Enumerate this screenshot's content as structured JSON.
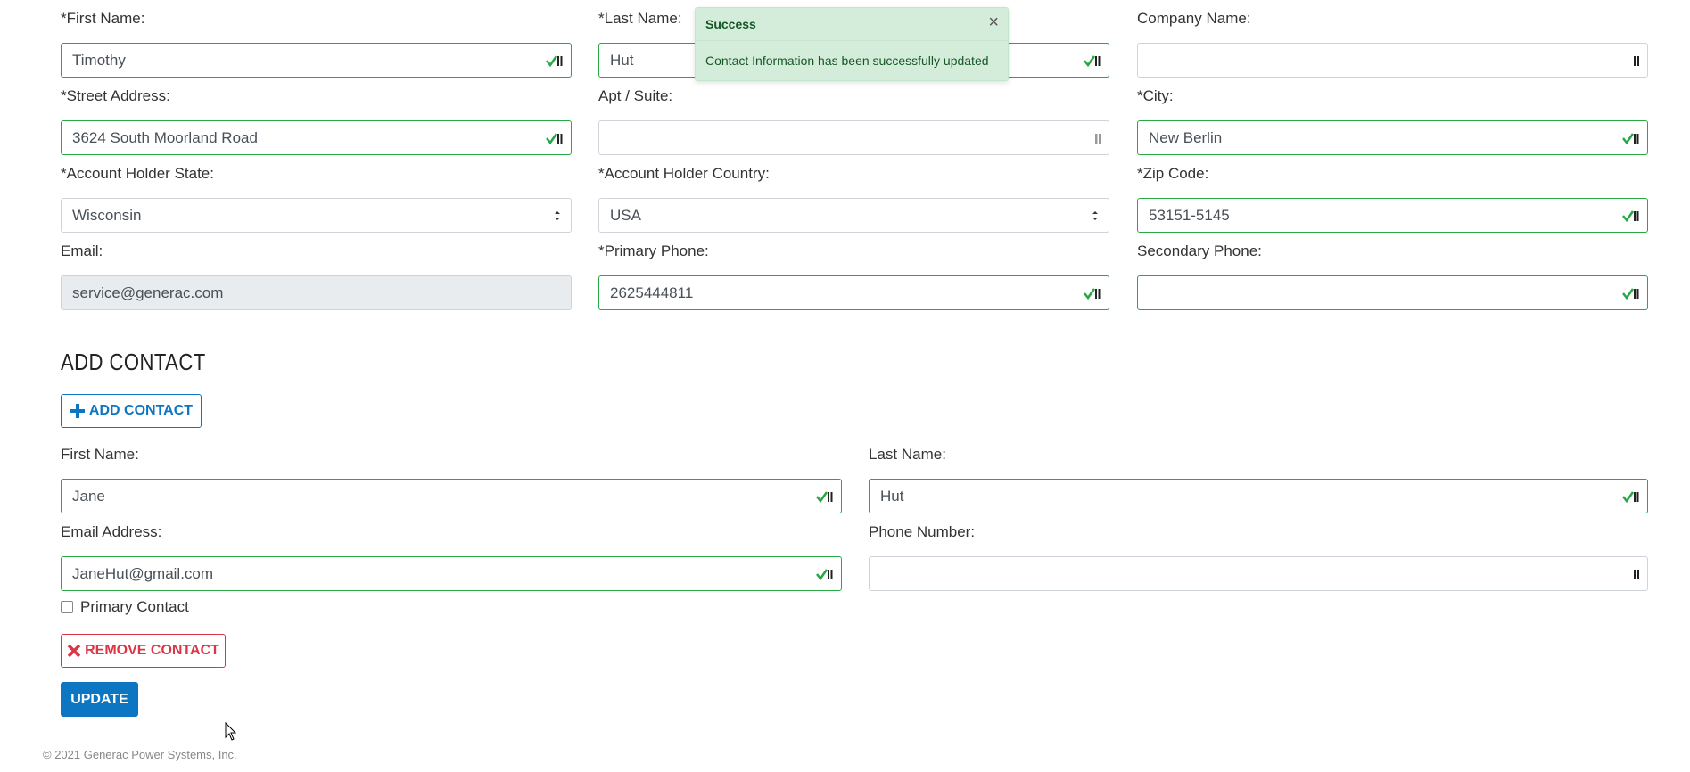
{
  "account": {
    "first_name": {
      "label": "*First Name:",
      "value": "Timothy"
    },
    "last_name": {
      "label": "*Last Name:",
      "value": "Hut"
    },
    "company_name": {
      "label": "Company Name:",
      "value": ""
    },
    "street_address": {
      "label": "*Street Address:",
      "value": "3624 South Moorland Road"
    },
    "apt_suite": {
      "label": "Apt / Suite:",
      "value": ""
    },
    "city": {
      "label": "*City:",
      "value": "New Berlin"
    },
    "state": {
      "label": "*Account Holder State:",
      "value": "Wisconsin"
    },
    "country": {
      "label": "*Account Holder Country:",
      "value": "USA"
    },
    "zip": {
      "label": "*Zip Code:",
      "value": "53151-5145"
    },
    "email": {
      "label": "Email:",
      "value": "service@generac.com"
    },
    "primary_phone": {
      "label": "*Primary Phone:",
      "value": "2625444811"
    },
    "secondary_phone": {
      "label": "Secondary Phone:",
      "value": ""
    }
  },
  "add_contact": {
    "title": "ADD CONTACT",
    "button_label": "ADD CONTACT",
    "first_name": {
      "label": "First Name:",
      "value": "Jane"
    },
    "last_name": {
      "label": "Last Name:",
      "value": "Hut"
    },
    "email": {
      "label": "Email Address:",
      "value": "JaneHut@gmail.com"
    },
    "phone": {
      "label": "Phone Number:",
      "value": ""
    },
    "primary_contact_label": "Primary Contact",
    "remove_label": "REMOVE CONTACT"
  },
  "update_label": "UPDATE",
  "footer": "© 2021 Generac Power Systems, Inc.",
  "toast": {
    "title": "Success",
    "close": "×",
    "message": "Contact Information has been successfully updated"
  },
  "colors": {
    "valid": "#28a745",
    "primary": "#0d76c2",
    "danger": "#dc3545",
    "toast_bg": "#d4edda"
  },
  "icons": [
    "valid-check-icon",
    "password-manager-icon",
    "select-caret-icon",
    "plus-icon",
    "x-icon",
    "close-icon",
    "mouse-cursor-icon"
  ]
}
